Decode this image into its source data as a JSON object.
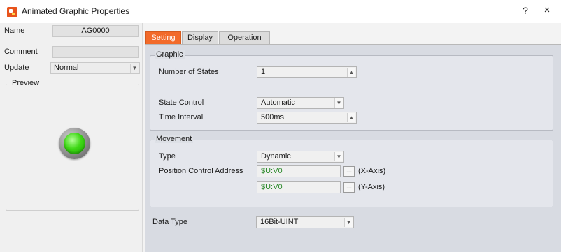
{
  "window": {
    "title": "Animated Graphic Properties",
    "help_glyph": "?",
    "close_glyph": "×",
    "app_icon": "animated-graphic-app-icon"
  },
  "left_panel": {
    "name_label": "Name",
    "name_value": "AG0000",
    "comment_label": "Comment",
    "comment_value": "",
    "update_label": "Update",
    "update_value": "Normal",
    "preview_legend": "Preview",
    "lamp_state_color": "#3fd816"
  },
  "tabs": [
    {
      "label": "Setting",
      "active": true
    },
    {
      "label": "Display",
      "active": false
    },
    {
      "label": "Operation",
      "active": false
    }
  ],
  "graphic": {
    "legend": "Graphic",
    "number_of_states_label": "Number of States",
    "number_of_states_value": "1",
    "state_control_label": "State Control",
    "state_control_value": "Automatic",
    "time_interval_label": "Time Interval",
    "time_interval_value": "500ms"
  },
  "movement": {
    "legend": "Movement",
    "type_label": "Type",
    "type_value": "Dynamic",
    "position_label": "Position Control Address",
    "x_address": "$U:V0",
    "x_axis_label": "(X-Axis)",
    "y_address": "$U:V0",
    "y_axis_label": "(Y-Axis)",
    "browse_glyph": "..."
  },
  "data_type": {
    "label": "Data Type",
    "value": "16Bit-UINT"
  },
  "colors": {
    "active_tab": "#f26a2a",
    "address_text": "#2c8a2c",
    "content_bg": "#d8dbe2"
  }
}
